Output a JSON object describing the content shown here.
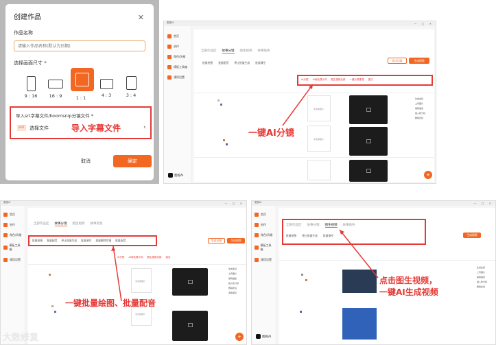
{
  "dialog": {
    "title": "创建作品",
    "close_icon": "close-icon",
    "name_label": "作品名称",
    "name_placeholder": "请输入作品名称(默认为日期)",
    "size_label": "选择画面尺寸 *",
    "ratios": [
      "9 : 16",
      "16 : 9",
      "1 : 1",
      "4 : 3",
      "3 : 4"
    ],
    "selected_ratio": "1 : 1",
    "import_label": "导入srt字幕文件/boomsnip分镜文件 *",
    "srt_badge": "SRT",
    "choose_file": "选择文件",
    "import_hint": "导入字幕文件",
    "cancel": "取消",
    "confirm": "确定"
  },
  "window": {
    "title": "图视AI",
    "controls": "— □ ✕",
    "sidebar": [
      "首页",
      "创作",
      "角色/风格",
      "模板工具箱",
      "通用设置"
    ],
    "logo": "图视AI",
    "tabs": [
      "全部作品区",
      "故事分镜",
      "图生视频",
      "故事角色"
    ],
    "tools": [
      "批量绘图",
      "批量配音",
      "停止批量生成",
      "批量清空",
      "批量删除空镜",
      "批量配音"
    ],
    "red_actions": [
      "AI分镜",
      "AI润色提示词",
      "图生视频全部",
      "一键分镜推理",
      "一键已生图视频",
      "一键已生图配音",
      "重试"
    ],
    "export_btn": "导出记录",
    "export_video_btn": "生成视频",
    "placeholder_text": "未选择图片",
    "select_image": "选择图片",
    "ops": [
      "生成此镜",
      "上传图片",
      "编辑描述",
      "插入新分镜",
      "删除此镜",
      "选取保存"
    ],
    "fab": "+"
  },
  "annotations": {
    "ai_storyboard": "一键AI分镜",
    "batch": "一键批量绘图、批量配音",
    "img2video": "点击图生视频，\n一键AI生成视频"
  },
  "watermark": "大数修复",
  "colors": {
    "accent": "#f26722",
    "highlight": "#e53935"
  }
}
